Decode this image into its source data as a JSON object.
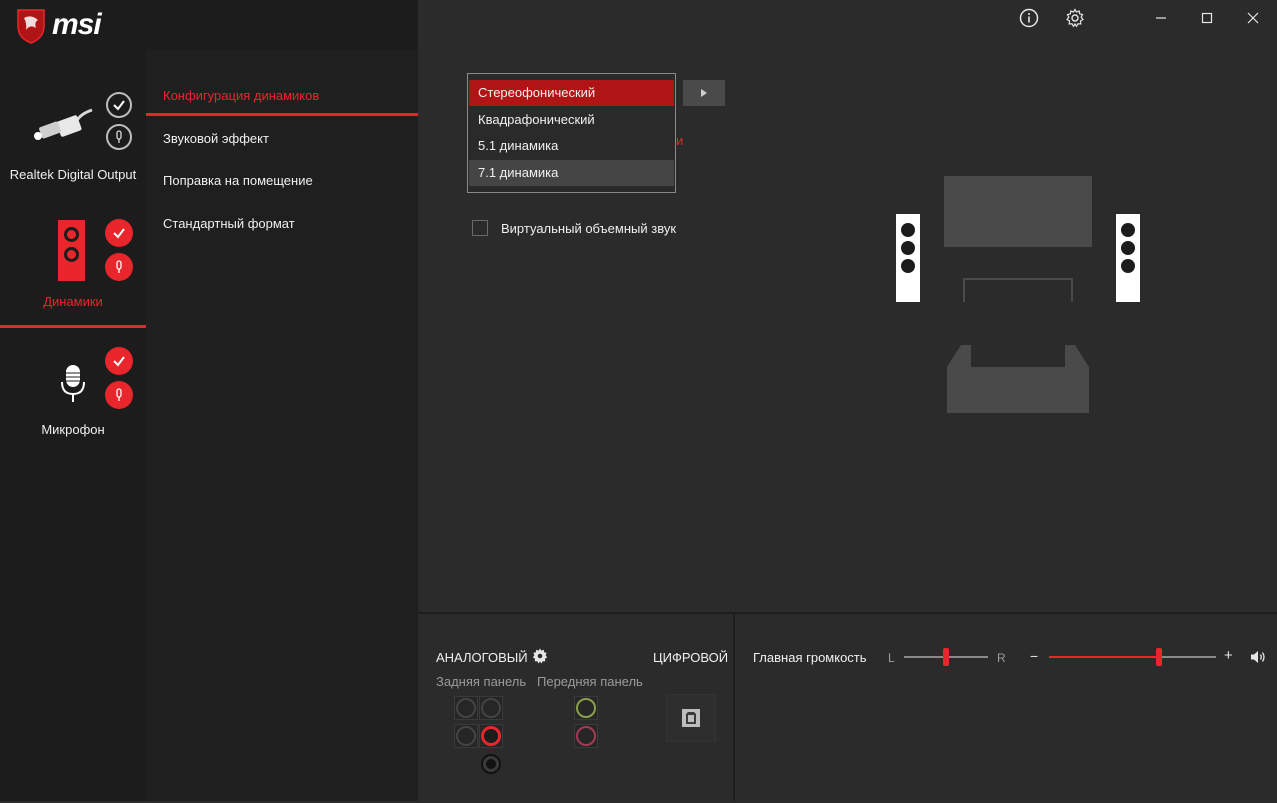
{
  "app": {
    "brand": "msi"
  },
  "title_bar": {
    "info_icon": "info-icon",
    "settings_icon": "gear-icon"
  },
  "devices": [
    {
      "label": "Realtek Digital Output",
      "active": false
    },
    {
      "label": "Динамики",
      "active": true
    },
    {
      "label": "Микрофон",
      "active": false
    }
  ],
  "menu": [
    {
      "label": "Конфигурация динамиков",
      "active": true
    },
    {
      "label": "Звуковой эффект",
      "active": false
    },
    {
      "label": "Поправка на помещение",
      "active": false
    },
    {
      "label": "Стандартный формат",
      "active": false
    }
  ],
  "speaker_config": {
    "options": [
      "Стереофонический",
      "Квадрафонический",
      "5.1 динамика",
      "7.1 динамика"
    ],
    "selected": "Стереофонический",
    "hovered": "7.1 динамика",
    "partial_text": "и",
    "virtual_surround_label": "Виртуальный объемный звук",
    "virtual_surround_checked": false
  },
  "bottom": {
    "analog_label": "АНАЛОГОВЫЙ",
    "digital_label": "ЦИФРОВОЙ",
    "rear_panel_label": "Задняя панель",
    "front_panel_label": "Передняя панель",
    "master_volume_label": "Главная громкость",
    "balance_left": "L",
    "balance_right": "R",
    "minus": "−",
    "plus": "+",
    "balance_value": 0.5,
    "volume_value": 0.66,
    "colors": {
      "accent": "#e8262b",
      "jack_green": "#8aa04a",
      "jack_pink": "#a33a55"
    }
  }
}
